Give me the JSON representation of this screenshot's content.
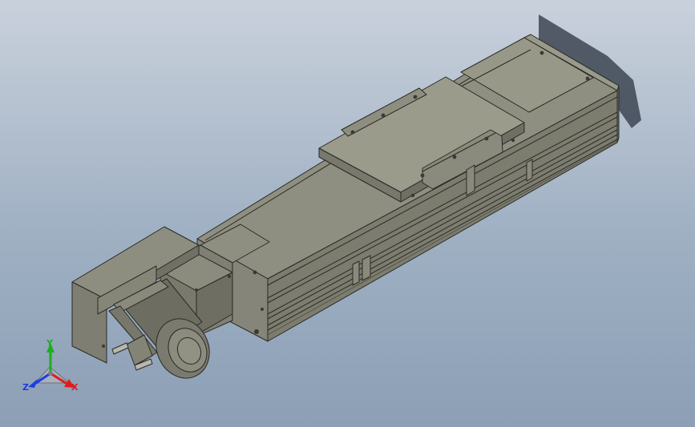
{
  "viewport": {
    "background_top": "#c9d1dc",
    "background_bottom": "#8c9fb5"
  },
  "model": {
    "body_color": "#8d8d7f",
    "edge_color": "#2a2a26",
    "shadow_color": "#3d4552"
  },
  "triad": {
    "x_label": "X",
    "y_label": "Y",
    "z_label": "Z",
    "x_color": "#e01b1b",
    "y_color": "#19b01a",
    "z_color": "#1c3de0"
  }
}
